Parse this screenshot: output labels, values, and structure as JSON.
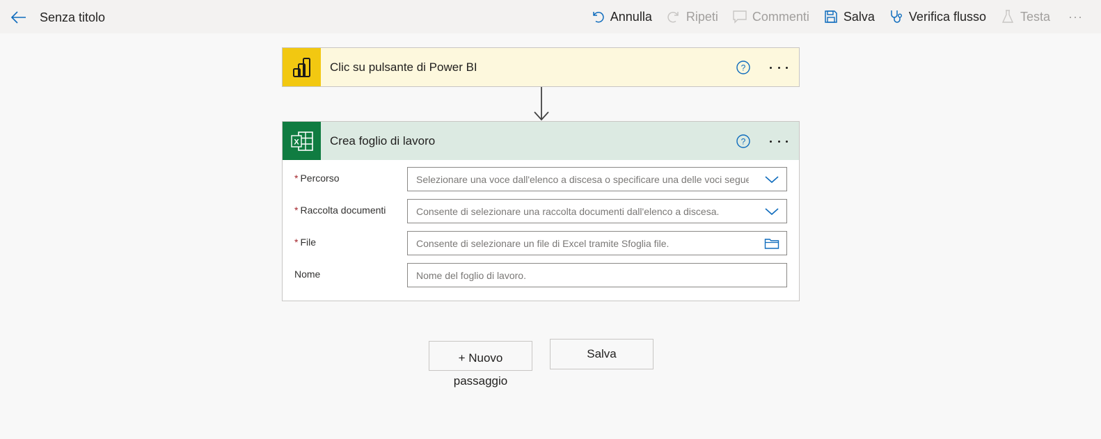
{
  "header": {
    "title": "Senza titolo",
    "commands": {
      "undo": "Annulla",
      "redo": "Ripeti",
      "comments": "Commenti",
      "save": "Salva",
      "check": "Verifica flusso",
      "test": "Testa",
      "more": "···"
    }
  },
  "trigger": {
    "title": "Clic su pulsante di Power BI",
    "icon": "power-bi-icon"
  },
  "action": {
    "title": "Crea foglio di lavoro",
    "icon": "excel-icon",
    "fields": [
      {
        "label": "Percorso",
        "required": true,
        "placeholder": "Selezionare una voce dall'elenco a discesa o specificare una delle voci seguenti",
        "type": "dropdown"
      },
      {
        "label": "Raccolta documenti",
        "required": true,
        "placeholder": "Consente di selezionare una raccolta documenti dall'elenco a discesa.",
        "type": "dropdown"
      },
      {
        "label": "File",
        "required": true,
        "placeholder": "Consente di selezionare un file di Excel tramite Sfoglia file.",
        "type": "file-picker"
      },
      {
        "label": "Nome",
        "required": false,
        "placeholder": "Nome del foglio di lavoro.",
        "type": "text"
      }
    ]
  },
  "footer": {
    "new_step": "+ Nuovo\npassaggio",
    "new_step_line1": "+ Nuovo",
    "new_step_line2": "passaggio",
    "save": "Salva"
  },
  "colors": {
    "accent": "#0f6cbd",
    "powerbi": "#f2c811",
    "excel": "#107c41",
    "required": "#a4262c"
  }
}
